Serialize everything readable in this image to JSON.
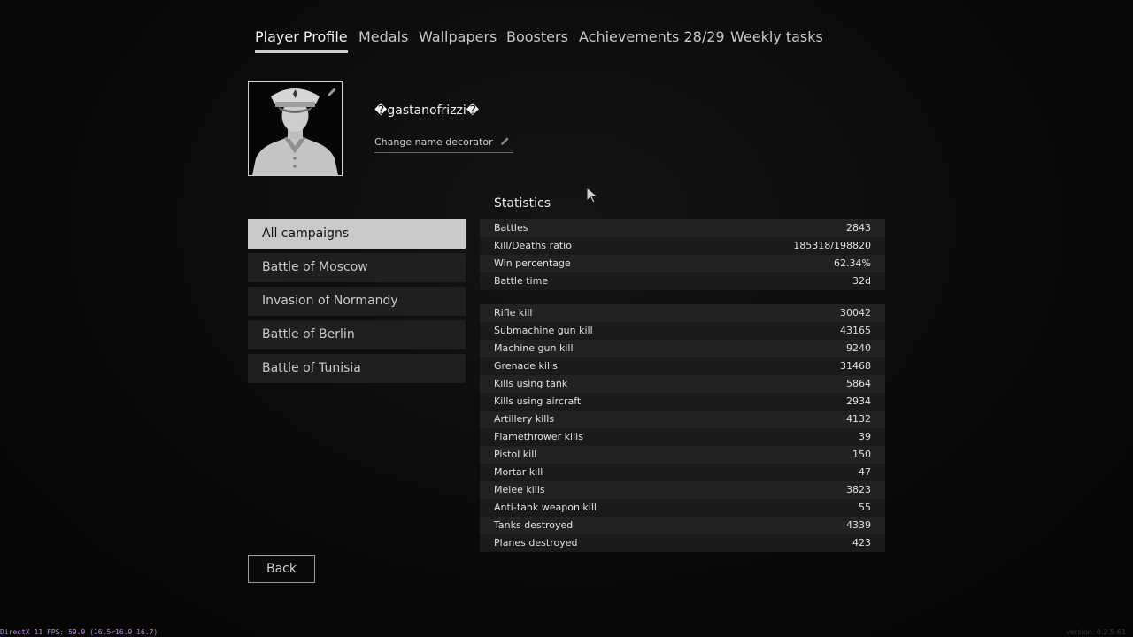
{
  "tabs": [
    {
      "label": "Player Profile",
      "active": true
    },
    {
      "label": "Medals"
    },
    {
      "label": "Wallpapers"
    },
    {
      "label": "Boosters"
    },
    {
      "label": "Achievements 28/29"
    },
    {
      "label": "Weekly tasks"
    }
  ],
  "profile": {
    "name": "�gastanofrizzi�",
    "change_decorator": "Change name decorator",
    "avatar_icon": "officer-portrait"
  },
  "campaigns": [
    {
      "label": "All campaigns",
      "active": true
    },
    {
      "label": "Battle of Moscow"
    },
    {
      "label": "Invasion of Normandy"
    },
    {
      "label": "Battle of Berlin"
    },
    {
      "label": "Battle of Tunisia"
    }
  ],
  "statistics": {
    "title": "Statistics",
    "summary": [
      {
        "label": "Battles",
        "value": "2843"
      },
      {
        "label": "Kill/Deaths ratio",
        "value": "185318/198820"
      },
      {
        "label": "Win percentage",
        "value": "62.34%"
      },
      {
        "label": "Battle time",
        "value": "32d"
      }
    ],
    "kills": [
      {
        "label": "Rifle kill",
        "value": "30042"
      },
      {
        "label": "Submachine gun kill",
        "value": "43165"
      },
      {
        "label": "Machine gun kill",
        "value": "9240"
      },
      {
        "label": "Grenade kills",
        "value": "31468"
      },
      {
        "label": "Kills using tank",
        "value": "5864"
      },
      {
        "label": "Kills using aircraft",
        "value": "2934"
      },
      {
        "label": "Artillery kills",
        "value": "4132"
      },
      {
        "label": "Flamethrower kills",
        "value": "39"
      },
      {
        "label": "Pistol kill",
        "value": "150"
      },
      {
        "label": "Mortar kill",
        "value": "47"
      },
      {
        "label": "Melee kills",
        "value": "3823"
      },
      {
        "label": "Anti-tank weapon kill",
        "value": "55"
      },
      {
        "label": "Tanks destroyed",
        "value": "4339"
      },
      {
        "label": "Planes destroyed",
        "value": "423"
      }
    ]
  },
  "back_label": "Back",
  "fps_text": "DirectX 11 FPS: 59.9 (16.5<16.9 16.7)",
  "version_text": "version: 0.2.5.61"
}
